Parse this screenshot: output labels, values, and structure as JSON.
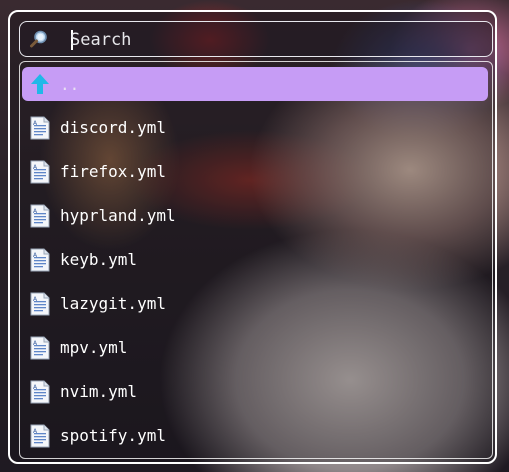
{
  "search": {
    "placeholder": "Search",
    "value": ""
  },
  "list": {
    "items": [
      {
        "label": "..",
        "icon": "arrow-up-icon",
        "selected": true
      },
      {
        "label": "discord.yml",
        "icon": "file-icon"
      },
      {
        "label": "firefox.yml",
        "icon": "file-icon"
      },
      {
        "label": "hyprland.yml",
        "icon": "file-icon"
      },
      {
        "label": "keyb.yml",
        "icon": "file-icon"
      },
      {
        "label": "lazygit.yml",
        "icon": "file-icon"
      },
      {
        "label": "mpv.yml",
        "icon": "file-icon"
      },
      {
        "label": "nvim.yml",
        "icon": "file-icon"
      },
      {
        "label": "spotify.yml",
        "icon": "file-icon"
      }
    ]
  },
  "colors": {
    "selection": "#c69cf5",
    "up_arrow": "#20b8e8",
    "border": "#ffffff"
  }
}
